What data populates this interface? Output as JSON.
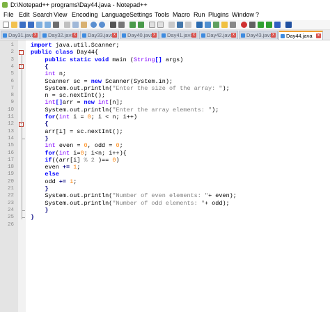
{
  "window": {
    "title": "D:\\Notepad++ programs\\Day44.java - Notepad++"
  },
  "menu": [
    "File",
    "Edit",
    "Search",
    "View",
    "Encoding",
    "Language",
    "Settings",
    "Tools",
    "Macro",
    "Run",
    "Plugins",
    "Window",
    "?"
  ],
  "tabs": [
    {
      "label": "Day31.java",
      "active": false
    },
    {
      "label": "Day32.java",
      "active": false
    },
    {
      "label": "Day33.java",
      "active": false
    },
    {
      "label": "Day40.java",
      "active": false
    },
    {
      "label": "Day41.java",
      "active": false
    },
    {
      "label": "Day42.java",
      "active": false
    },
    {
      "label": "Day43.java",
      "active": false
    },
    {
      "label": "Day44.java",
      "active": true
    }
  ],
  "tab_close_glyph": "x",
  "fold": {
    "open_glyph": "-"
  },
  "colors": {
    "keyword": "#0000ff",
    "type": "#8000ff",
    "string": "#808080",
    "number": "#ff8000",
    "active_tab": "#f0a030",
    "line_numbers": "#8a8a8a"
  },
  "editor": {
    "lines": [
      {
        "n": "1",
        "segs": [
          [
            "kw",
            "import"
          ],
          [
            "",
            ""
          ],
          [
            "",
            " java.util.Scanner;"
          ]
        ]
      },
      {
        "n": "2",
        "segs": [
          [
            "kw",
            "public class"
          ],
          [
            "",
            " Day44{"
          ]
        ]
      },
      {
        "n": "3",
        "segs": [
          [
            "kw",
            "    public static void"
          ],
          [
            "",
            " main ("
          ],
          [
            "ty",
            "String"
          ],
          [
            "kw",
            "[]"
          ],
          [
            "",
            " args)"
          ]
        ]
      },
      {
        "n": "4",
        "segs": [
          [
            "op",
            "    {"
          ]
        ]
      },
      {
        "n": "5",
        "segs": [
          [
            "ty",
            "    int"
          ],
          [
            "",
            " n;"
          ]
        ]
      },
      {
        "n": "6",
        "segs": [
          [
            "",
            "    Scanner sc = "
          ],
          [
            "kw",
            "new"
          ],
          [
            "",
            " Scanner(System.in);"
          ]
        ]
      },
      {
        "n": "7",
        "segs": [
          [
            "",
            "    System.out.println("
          ],
          [
            "st",
            "\"Enter the size of the array: \""
          ],
          [
            "",
            ");"
          ]
        ]
      },
      {
        "n": "8",
        "segs": [
          [
            "",
            "    n = sc.nextInt();"
          ]
        ]
      },
      {
        "n": "9",
        "segs": [
          [
            "ty",
            "    int"
          ],
          [
            "kw",
            "[]"
          ],
          [
            "",
            "arr = "
          ],
          [
            "kw",
            "new"
          ],
          [
            "ty",
            " int"
          ],
          [
            "",
            "[n];"
          ]
        ]
      },
      {
        "n": "10",
        "segs": [
          [
            "",
            "    System.out.println("
          ],
          [
            "st",
            "\"Enter the array elements: \""
          ],
          [
            "",
            ");"
          ]
        ]
      },
      {
        "n": "11",
        "segs": [
          [
            "kw",
            "    for"
          ],
          [
            "",
            "("
          ],
          [
            "ty",
            "int"
          ],
          [
            "",
            " i = "
          ],
          [
            "nu",
            "0"
          ],
          [
            "",
            "; i < n; i++)"
          ]
        ]
      },
      {
        "n": "12",
        "segs": [
          [
            "op",
            "    {"
          ]
        ]
      },
      {
        "n": "13",
        "segs": [
          [
            "",
            "    arr[i] = sc.nextInt();"
          ]
        ]
      },
      {
        "n": "14",
        "segs": [
          [
            "op",
            "    }"
          ]
        ]
      },
      {
        "n": "15",
        "segs": [
          [
            "ty",
            "    int"
          ],
          [
            "",
            " even = "
          ],
          [
            "nu",
            "0"
          ],
          [
            "",
            ", odd = "
          ],
          [
            "nu",
            "0"
          ],
          [
            "",
            ";"
          ]
        ]
      },
      {
        "n": "16",
        "segs": [
          [
            "kw",
            "    for"
          ],
          [
            "",
            "("
          ],
          [
            "ty",
            "int"
          ],
          [
            "",
            " i="
          ],
          [
            "nu",
            "0"
          ],
          [
            "",
            "; i<n; i++){"
          ]
        ]
      },
      {
        "n": "17",
        "segs": [
          [
            "kw",
            "    if"
          ],
          [
            "",
            "((arr[i] "
          ],
          [
            "st",
            "% 2 "
          ],
          [
            "",
            ")== "
          ],
          [
            "nu",
            "0"
          ],
          [
            "",
            ")"
          ]
        ]
      },
      {
        "n": "18",
        "segs": [
          [
            "",
            "    even "
          ],
          [
            "op",
            "+="
          ],
          [
            "",
            " "
          ],
          [
            "nu",
            "1"
          ],
          [
            "",
            ";"
          ]
        ]
      },
      {
        "n": "19",
        "segs": [
          [
            "kw",
            "    else"
          ]
        ]
      },
      {
        "n": "20",
        "segs": [
          [
            "",
            "    odd "
          ],
          [
            "op",
            "+="
          ],
          [
            "",
            " "
          ],
          [
            "nu",
            "1"
          ],
          [
            "",
            ";"
          ]
        ]
      },
      {
        "n": "21",
        "segs": [
          [
            "op",
            "    }"
          ]
        ]
      },
      {
        "n": "22",
        "segs": [
          [
            "",
            "    System.out.println("
          ],
          [
            "st",
            "\"Number of even elements: \""
          ],
          [
            "",
            "+ even);"
          ]
        ]
      },
      {
        "n": "23",
        "segs": [
          [
            "",
            "    System.out.println("
          ],
          [
            "st",
            "\"Number of odd elements: \""
          ],
          [
            "",
            "+ odd);"
          ]
        ]
      },
      {
        "n": "24",
        "segs": [
          [
            "op",
            "    }"
          ]
        ]
      },
      {
        "n": "25",
        "segs": [
          [
            "op",
            "}"
          ]
        ]
      },
      {
        "n": "26",
        "segs": [
          [
            "",
            ""
          ]
        ]
      }
    ]
  }
}
